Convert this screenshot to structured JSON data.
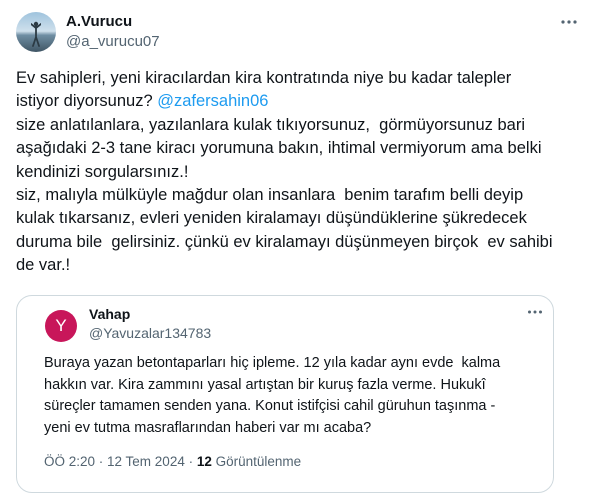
{
  "tweet": {
    "author_name": "A.Vurucu",
    "author_handle": "@a_vurucu07",
    "avatar_icon": "avatar-photo-person-at-lake",
    "more_icon": "more-horizontal-icon",
    "text_before_mention": "Ev sahipleri, yeni kiracılardan kira kontratında niye bu kadar talepler\nistiyor diyorsunuz? ",
    "mention": "@zafersahin06",
    "text_after_mention": "\nsize anlatılanlara, yazılanlara kulak tıkıyorsunuz,  görmüyorsunuz bari\naşağıdaki 2-3 tane kiracı yorumuna bakın, ihtimal vermiyorum ama belki\nkendinizi sorgularsınız.!\nsiz, malıyla mülküyle mağdur olan insanlara  benim tarafım belli deyip\nkulak tıkarsanız, evleri yeniden kiralamayı düşündüklerine şükredecek\nduruma bile  gelirsiniz. çünkü ev kiralamayı düşünmeyen birçok  ev sahibi\nde var.!"
  },
  "quoted": {
    "avatar_letter": "Y",
    "avatar_color": "#c8165a",
    "author_name": "Vahap",
    "author_handle": "@Yavuzalar134783",
    "more_icon": "more-horizontal-icon",
    "text": "Buraya yazan betontaparları hiç ipleme. 12 yıla kadar aynı evde  kalma\nhakkın var. Kira zammını yasal artıştan bir kuruş fazla verme. Hukukî\nsüreçler tamamen senden yana. Konut istifçisi cahil güruhun taşınma -\nyeni ev tutma masraflarından haberi var mı acaba?",
    "timestamp": "ÖÖ 2:20 · 12 Tem 2024 · ",
    "views_count": "12",
    "views_label": " Görüntülenme"
  },
  "colors": {
    "link": "#1d9bf0",
    "text": "#0f1419",
    "secondary": "#536471",
    "border": "#cfd9de"
  }
}
